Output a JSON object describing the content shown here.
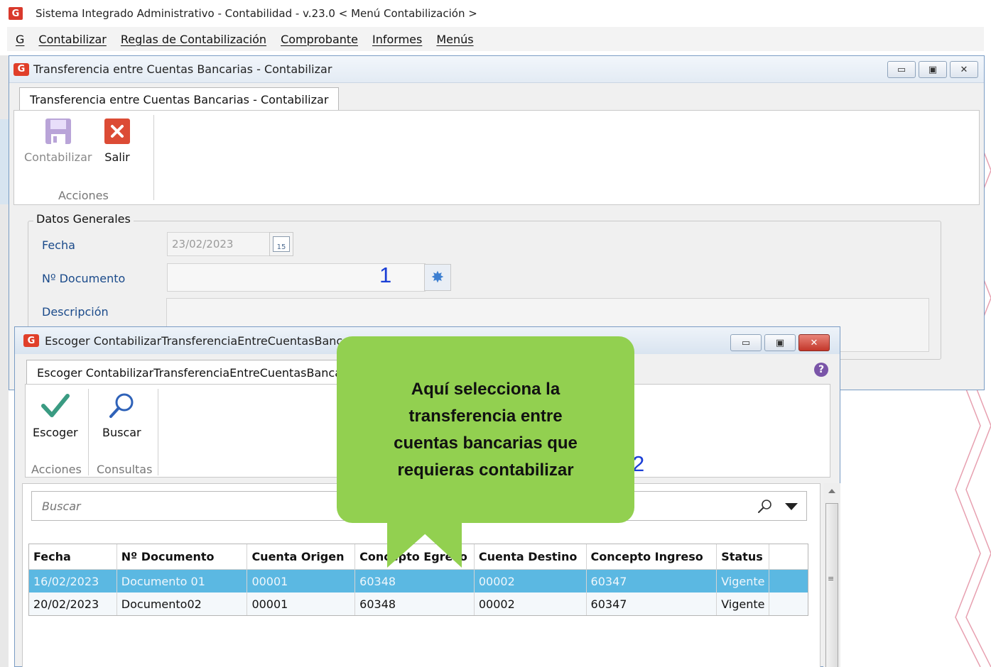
{
  "app": {
    "title": "Sistema Integrado Administrativo - Contabilidad - v.23.0 < Menú Contabilización >",
    "logo": "G"
  },
  "menu": {
    "items": [
      "G",
      "Contabilizar",
      "Reglas de Contabilización",
      "Comprobante",
      "Informes",
      "Menús"
    ]
  },
  "window1": {
    "title": "Transferencia entre Cuentas Bancarias - Contabilizar",
    "tab": "Transferencia entre Cuentas Bancarias - Contabilizar",
    "buttons": {
      "contabilizar": "Contabilizar",
      "salir": "Salir"
    },
    "group_label": "Acciones",
    "section_title": "Datos Generales",
    "fields": {
      "fecha_label": "Fecha",
      "fecha_value": "23/02/2023",
      "documento_label": "Nº Documento",
      "documento_value": "",
      "descripcion_label": "Descripción",
      "descripcion_value": ""
    },
    "calendar_day": "15"
  },
  "annotations": {
    "one": "1",
    "two": "2"
  },
  "dialog": {
    "title": "Escoger ContabilizarTransferenciaEntreCuentasBanca",
    "tab": "Escoger ContabilizarTransferenciaEntreCuentasBanca",
    "buttons": {
      "escoger": "Escoger",
      "buscar": "Buscar"
    },
    "groups": {
      "acciones": "Acciones",
      "consultas": "Consultas"
    },
    "search_placeholder": "Buscar",
    "table": {
      "headers": [
        "Fecha",
        "Nº Documento",
        "Cuenta Origen",
        "Concepto Egreso",
        "Cuenta Destino",
        "Concepto Ingreso",
        "Status",
        ""
      ],
      "rows": [
        [
          "16/02/2023",
          "Documento 01",
          "00001",
          "60348",
          "00002",
          "60347",
          "Vigente",
          ""
        ],
        [
          "20/02/2023",
          "Documento02",
          "00001",
          "60348",
          "00002",
          "60347",
          "Vigente",
          ""
        ]
      ],
      "selected_row": 0
    }
  },
  "callout": {
    "text": "Aquí selecciona la\ntransferencia entre\ncuentas bancarias que\nrequieras contabilizar",
    "color": "#92d050"
  },
  "colors": {
    "selection": "#5bb8e2",
    "accent_red": "#e03f2a",
    "label_blue": "#1a4a8a"
  }
}
